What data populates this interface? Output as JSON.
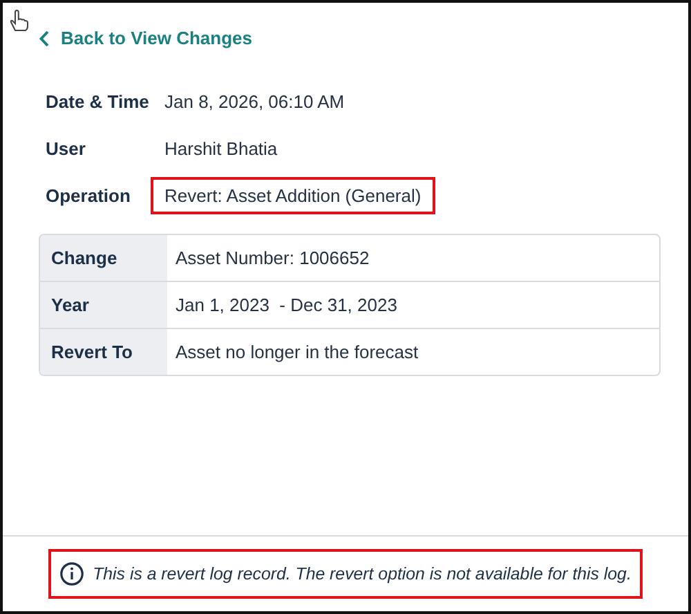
{
  "back_link": {
    "label": "Back to View Changes"
  },
  "details": [
    {
      "label": "Date & Time",
      "value": "Jan 8, 2026, 06:10 AM",
      "highlighted": false
    },
    {
      "label": "User",
      "value": "Harshit Bhatia",
      "highlighted": false
    },
    {
      "label": "Operation",
      "value": "Revert: Asset Addition (General)",
      "highlighted": true
    }
  ],
  "change_table": [
    {
      "label": "Change",
      "value": "Asset Number: 1006652"
    },
    {
      "label": "Year",
      "value": "Jan 1, 2023  - Dec 31, 2023"
    },
    {
      "label": "Revert To",
      "value": "Asset no longer in the forecast"
    }
  ],
  "notice": {
    "text": "This is a revert log record. The revert option is not available for this log.",
    "highlighted": true
  }
}
